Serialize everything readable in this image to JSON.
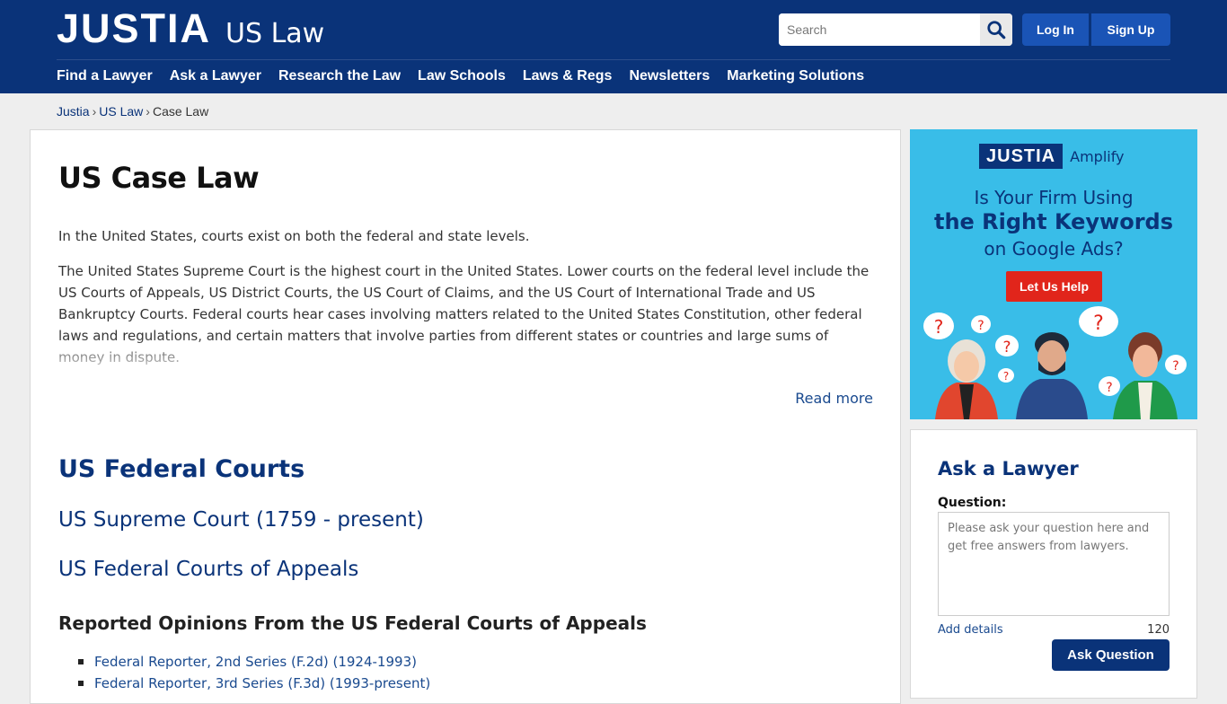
{
  "header": {
    "logo": "JUSTIA",
    "logo_sub": "US Law",
    "search_placeholder": "Search",
    "login_label": "Log In",
    "signup_label": "Sign Up",
    "nav": [
      "Find a Lawyer",
      "Ask a Lawyer",
      "Research the Law",
      "Law Schools",
      "Laws & Regs",
      "Newsletters",
      "Marketing Solutions"
    ],
    "colors": {
      "bar": "#0a3379",
      "buttons": "#1a54b6"
    }
  },
  "breadcrumb": [
    "Justia",
    "US Law",
    "Case Law"
  ],
  "main": {
    "title": "US Case Law",
    "paragraphs": [
      "In the United States, courts exist on both the federal and state levels.",
      "The United States Supreme Court is the highest court in the United States. Lower courts on the federal level include the US Courts of Appeals, US District Courts, the US Court of Claims, and the US Court of International Trade and US Bankruptcy Courts. Federal courts hear cases involving matters related to the United States Constitution, other federal laws and regulations, and certain matters that involve parties from different states or countries and large sums of money in dispute."
    ],
    "read_more": "Read more",
    "federal_heading": "US Federal Courts",
    "supreme_link": "US Supreme Court (1759 - present)",
    "appeals_link": "US Federal Courts of Appeals",
    "reported_heading": "Reported Opinions From the US Federal Courts of Appeals",
    "reporters": [
      "Federal Reporter, 2nd Series (F.2d) (1924-1993)",
      "Federal Reporter, 3rd Series (F.3d) (1993-present)"
    ]
  },
  "ad": {
    "brand": "JUSTIA",
    "product": "Amplify",
    "line1": "Is Your Firm Using",
    "line2": "the Right Keywords",
    "line3": "on Google Ads?",
    "cta": "Let Us Help",
    "bubble_mark": "?",
    "colors": {
      "background": "#39bde8",
      "cta": "#e1251b"
    }
  },
  "ask": {
    "title": "Ask a Lawyer",
    "label": "Question:",
    "placeholder": "Please ask your question here and get free answers from lawyers.",
    "details_link": "Add details",
    "char_count": "120",
    "button": "Ask Question"
  }
}
